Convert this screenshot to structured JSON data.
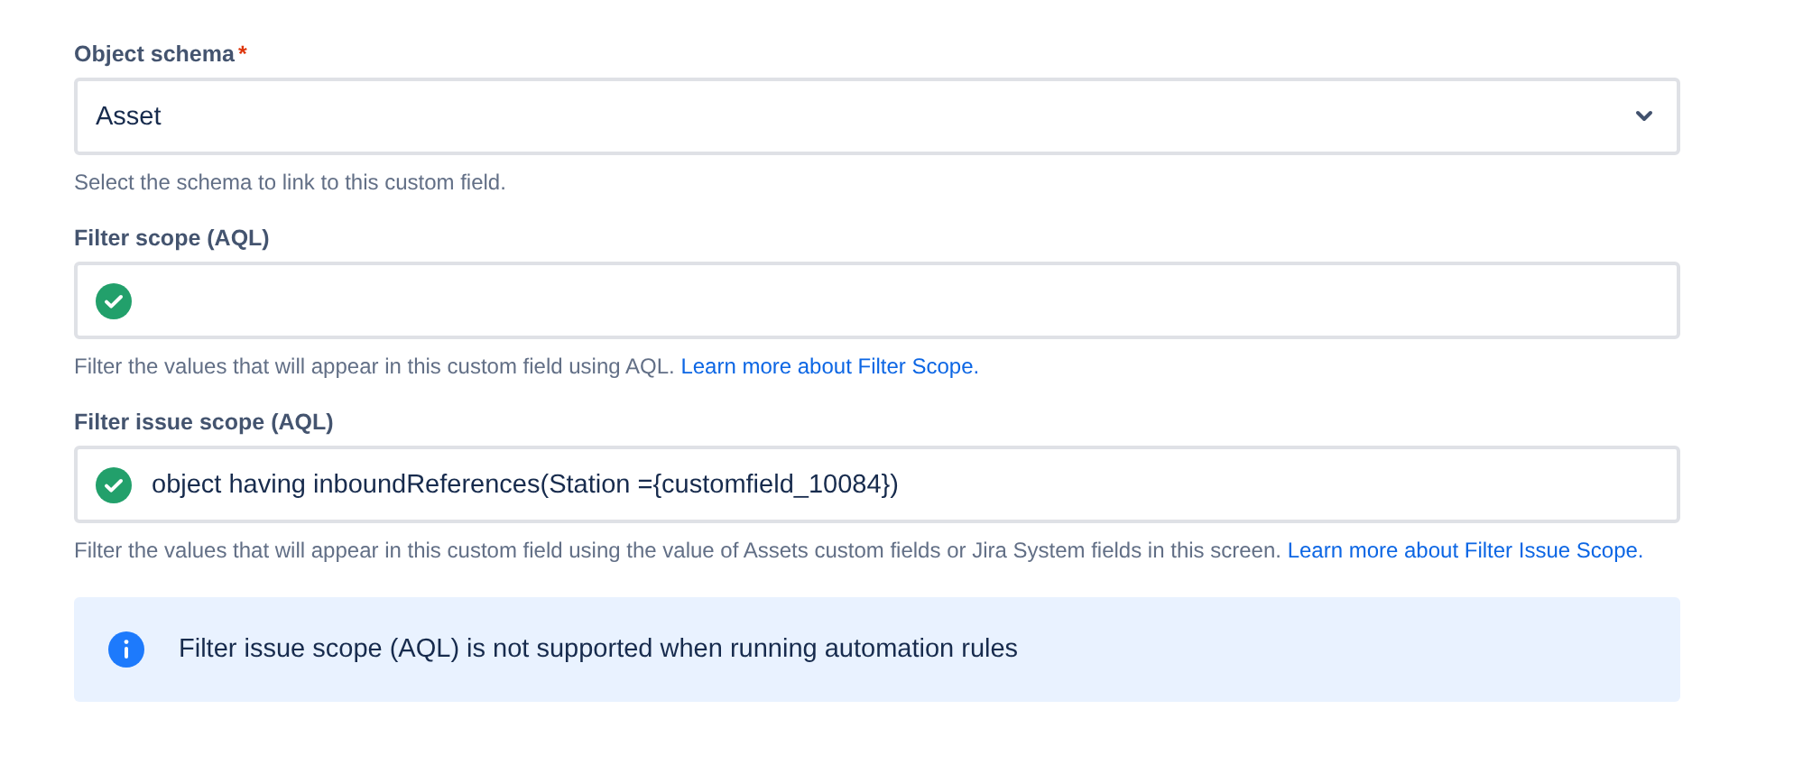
{
  "fields": [
    {
      "kind": "select",
      "label": "Object schema",
      "required_mark": "*",
      "value": "Asset",
      "help": "Select the schema to link to this custom field."
    },
    {
      "kind": "aql",
      "label": "Filter scope (AQL)",
      "valid": true,
      "help": "Filter the values that will appear in this custom field using AQL.",
      "link": "Learn more about Filter Scope."
    },
    {
      "kind": "aql",
      "label": "Filter issue scope (AQL)",
      "valid": true,
      "value": "object having inboundReferences(Station ={customfield_10084})",
      "help": "Filter the values that will appear in this custom field using the value of Assets custom fields or Jira System fields in this screen.",
      "link": "Learn more about Filter Issue Scope."
    }
  ],
  "info": {
    "message": "Filter issue scope (AQL) is not supported when running automation rules"
  }
}
